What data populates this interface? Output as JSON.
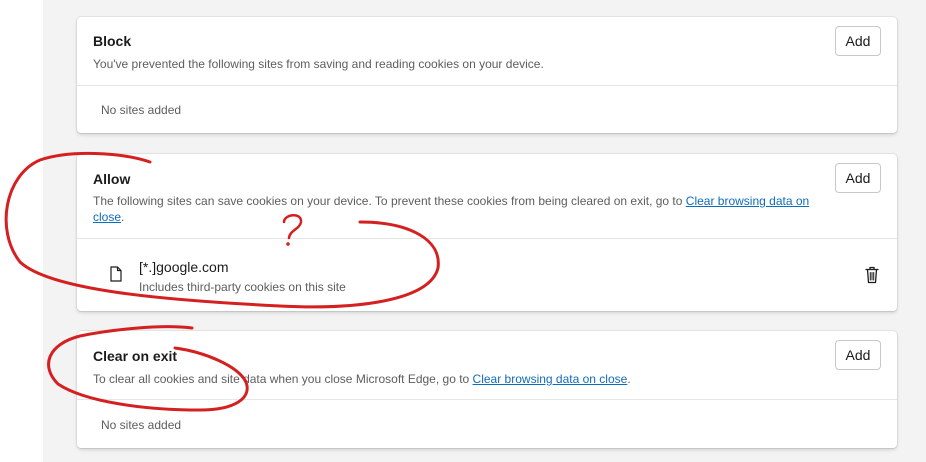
{
  "block": {
    "title": "Block",
    "description": "You've prevented the following sites from saving and reading cookies on your device.",
    "add_label": "Add",
    "empty": "No sites added"
  },
  "allow": {
    "title": "Allow",
    "description_before": "The following sites can save cookies on your device. To prevent these cookies from being cleared on exit, go to ",
    "link": "Clear browsing data on close",
    "description_after": ".",
    "add_label": "Add",
    "sites": [
      {
        "name": "[*.]google.com",
        "detail": "Includes third-party cookies on this site"
      }
    ]
  },
  "clear_on_exit": {
    "title": "Clear on exit",
    "description_before": "To clear all cookies and site data when you close Microsoft Edge, go to ",
    "link": "Clear browsing data on close",
    "description_after": ".",
    "add_label": "Add",
    "empty": "No sites added"
  },
  "annotations": {
    "question_mark": "?",
    "color": "#d42020"
  },
  "icons": {
    "file": "file-icon",
    "trash": "trash-icon"
  }
}
